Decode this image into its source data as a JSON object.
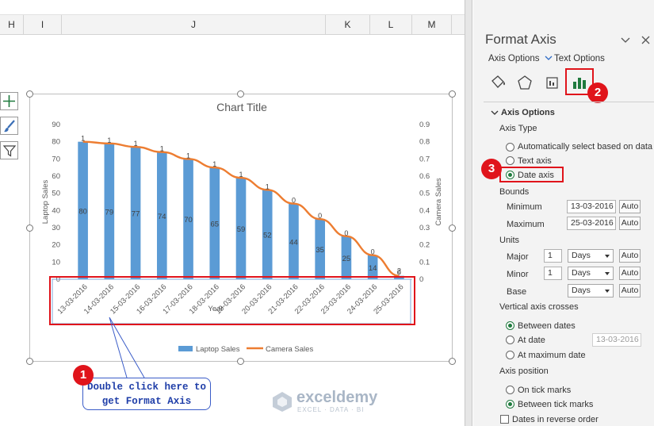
{
  "sheet": {
    "columns": [
      "H",
      "I",
      "J",
      "K",
      "L",
      "M"
    ]
  },
  "chart_data": {
    "type": "bar",
    "title": "Chart Title",
    "xlabel": "Year",
    "ylabel": "Laptop Sales",
    "y2label": "Camera Sales",
    "categories": [
      "13-03-2016",
      "14-03-2016",
      "15-03-2016",
      "16-03-2016",
      "17-03-2016",
      "18-03-2016",
      "19-03-2016",
      "20-03-2016",
      "21-03-2016",
      "22-03-2016",
      "23-03-2016",
      "24-03-2016",
      "25-03-2016"
    ],
    "series": [
      {
        "name": "Laptop Sales",
        "type": "bar",
        "axis": "left",
        "color": "#5b9bd5",
        "values": [
          80,
          79,
          77,
          74,
          70,
          65,
          59,
          52,
          44,
          35,
          25,
          14,
          2
        ],
        "labels": [
          "80",
          "79",
          "77",
          "74",
          "70",
          "65",
          "59",
          "52",
          "44",
          "35",
          "25",
          "14",
          "2"
        ]
      },
      {
        "name": "Camera Sales",
        "type": "line",
        "axis": "right",
        "color": "#ed7d31",
        "values": [
          0.8,
          0.79,
          0.77,
          0.74,
          0.7,
          0.65,
          0.59,
          0.52,
          0.44,
          0.35,
          0.25,
          0.14,
          0.02
        ],
        "labels": [
          "1",
          "1",
          "1",
          "1",
          "1",
          "1",
          "1",
          "1",
          "0",
          "0",
          "0",
          "0",
          "0"
        ]
      }
    ],
    "ylim": [
      0,
      90
    ],
    "yticks": [
      "0",
      "10",
      "20",
      "30",
      "40",
      "50",
      "60",
      "70",
      "80",
      "90"
    ],
    "y2lim": [
      0,
      0.9
    ],
    "y2ticks": [
      "0",
      "0.1",
      "0.2",
      "0.3",
      "0.4",
      "0.5",
      "0.6",
      "0.7",
      "0.8",
      "0.9"
    ],
    "grid": false,
    "legend_position": "bottom"
  },
  "callout": {
    "badge": "1",
    "line1": "Double click here to",
    "line2": "get Format Axis"
  },
  "watermark": {
    "name": "exceldemy",
    "sub": "EXCEL · DATA · BI"
  },
  "pane": {
    "title": "Format Axis",
    "tab_axis_options": "Axis Options",
    "tab_text_options": "Text Options",
    "badge2": "2",
    "badge3": "3",
    "section": "Axis Options",
    "axis_type_label": "Axis Type",
    "auto_select": "Automatically select based on data",
    "text_axis": "Text axis",
    "date_axis": "Date axis",
    "bounds_label": "Bounds",
    "minimum_label": "Minimum",
    "minimum_value": "13-03-2016",
    "maximum_label": "Maximum",
    "maximum_value": "25-03-2016",
    "auto": "Auto",
    "units_label": "Units",
    "major_label": "Major",
    "major_value": "1",
    "major_unit": "Days",
    "minor_label": "Minor",
    "minor_value": "1",
    "minor_unit": "Days",
    "base_label": "Base",
    "base_unit": "Days",
    "vac_label": "Vertical axis crosses",
    "between_dates": "Between dates",
    "at_date": "At date",
    "at_date_value": "13-03-2016",
    "at_max_date": "At maximum date",
    "axis_position_label": "Axis position",
    "on_tick": "On tick marks",
    "between_tick": "Between tick marks",
    "reverse": "Dates in reverse order"
  }
}
